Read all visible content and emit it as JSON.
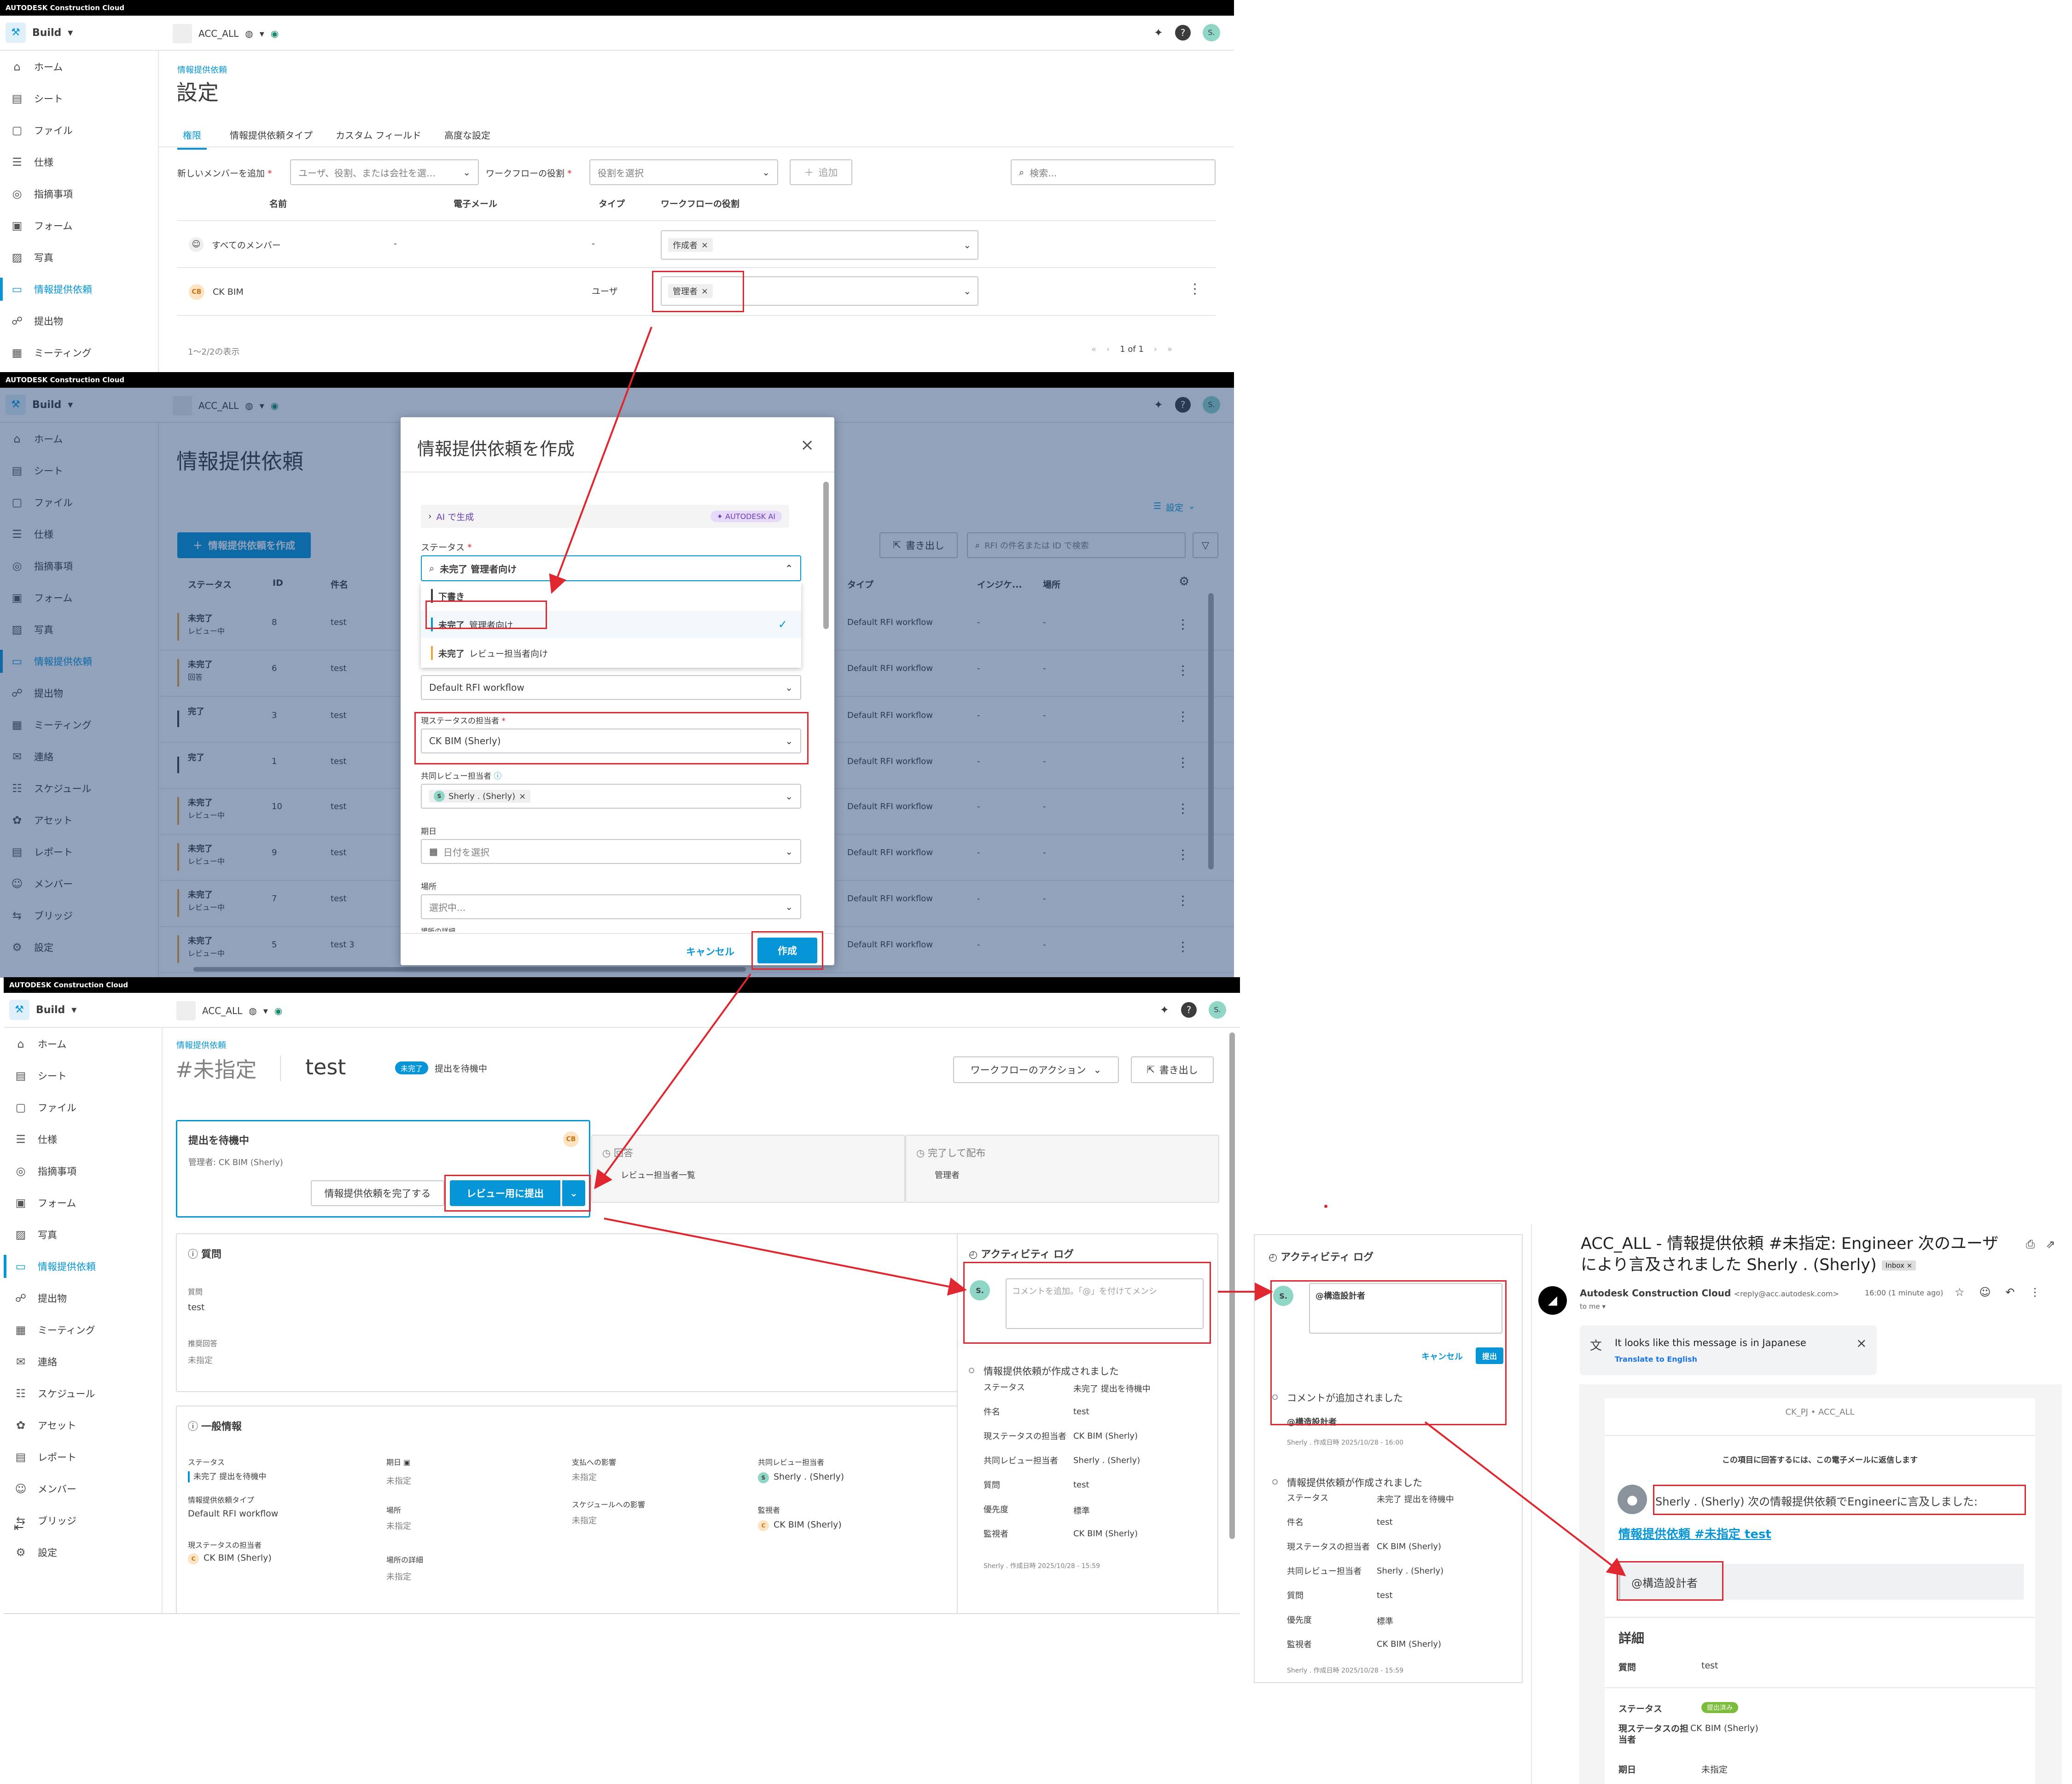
{
  "brand": "AUTODESK Construction Cloud",
  "header": {
    "app_menu": "Build",
    "project": "ACC_ALL",
    "user_initial": "S."
  },
  "sidebar": {
    "items": [
      "ホーム",
      "シート",
      "ファイル",
      "仕様",
      "指摘事項",
      "フォーム",
      "写真",
      "情報提供依頼",
      "提出物",
      "ミーティング",
      "連絡",
      "スケジュール",
      "アセット",
      "レポート",
      "メンバー",
      "ブリッジ",
      "設定"
    ],
    "icons": [
      "home-icon",
      "sheet-icon",
      "file-icon",
      "spec-icon",
      "issue-icon",
      "form-icon",
      "photo-icon",
      "rfi-icon",
      "submittal-icon",
      "meeting-icon",
      "mail-icon",
      "schedule-icon",
      "asset-icon",
      "report-icon",
      "members-icon",
      "bridge-icon",
      "gear-icon"
    ]
  },
  "settings": {
    "breadcrumb": "情報提供依頼",
    "title": "設定",
    "tabs": [
      "権限",
      "情報提供依頼タイプ",
      "カスタム フィールド",
      "高度な設定"
    ],
    "add_member_label": "新しいメンバーを追加",
    "add_member_placeholder": "ユーザ、役割、または会社を選…",
    "workflow_role_label": "ワークフローの役割",
    "role_placeholder": "役割を選択",
    "add_button": "追加",
    "search_placeholder": "検索...",
    "columns": [
      "名前",
      "電子メール",
      "タイプ",
      "ワークフローの役割"
    ],
    "rows": [
      {
        "name": "すべてのメンバー",
        "email": "-",
        "type": "-",
        "role": "作成者"
      },
      {
        "name": "CK BIM",
        "initials": "CB",
        "email": "",
        "type": "ユーザ",
        "role": "管理者"
      }
    ],
    "count_text": "1～2/2の表示",
    "pagination": "1 of 1"
  },
  "rfi_list": {
    "title": "情報提供依頼",
    "create_button": "情報提供依頼を作成",
    "settings_link": "設定",
    "export_button": "書き出し",
    "search_placeholder": "RFI の件名または ID で検索",
    "columns": [
      "ステータス",
      "ID",
      "件名",
      "タイプ",
      "インジケ...",
      "場所"
    ],
    "rows": [
      {
        "status": "未完了",
        "sub": "レビュー中",
        "id": "8",
        "subject": "test",
        "type": "Default RFI workflow",
        "ind": "-",
        "loc": "-",
        "color": "#f0a33c"
      },
      {
        "status": "未完了",
        "sub": "回答",
        "id": "6",
        "subject": "test",
        "type": "Default RFI workflow",
        "ind": "-",
        "loc": "-",
        "color": "#f0a33c"
      },
      {
        "status": "完了",
        "sub": "",
        "id": "3",
        "subject": "test",
        "type": "Default RFI workflow",
        "ind": "-",
        "loc": "-",
        "color": "#3c3c3c"
      },
      {
        "status": "完了",
        "sub": "",
        "id": "1",
        "subject": "test",
        "type": "Default RFI workflow",
        "ind": "-",
        "loc": "-",
        "color": "#3c3c3c"
      },
      {
        "status": "未完了",
        "sub": "レビュー中",
        "id": "10",
        "subject": "test",
        "type": "Default RFI workflow",
        "ind": "-",
        "loc": "-",
        "color": "#f0a33c"
      },
      {
        "status": "未完了",
        "sub": "レビュー中",
        "id": "9",
        "subject": "test",
        "type": "Default RFI workflow",
        "ind": "-",
        "loc": "-",
        "color": "#f0a33c"
      },
      {
        "status": "未完了",
        "sub": "レビュー中",
        "id": "7",
        "subject": "test",
        "type": "Default RFI workflow",
        "ind": "-",
        "loc": "-",
        "color": "#f0a33c"
      },
      {
        "status": "未完了",
        "sub": "レビュー中",
        "id": "5",
        "subject": "test 3",
        "type": "Default RFI workflow",
        "ind": "-",
        "loc": "-",
        "color": "#f0a33c"
      }
    ]
  },
  "modal": {
    "title": "情報提供依頼を作成",
    "ai_generate": "AI で生成",
    "ai_badge": "AUTODESK AI",
    "status_label": "ステータス",
    "status_value": "未完了 管理者向け",
    "options": [
      {
        "main": "下書き",
        "sub": "",
        "color": "#3c3c3c"
      },
      {
        "main": "未完了",
        "sub": "管理者向け",
        "color": "#0696d7"
      },
      {
        "main": "未完了",
        "sub": "レビュー担当者向け",
        "color": "#f0a33c"
      }
    ],
    "workflow_value": "Default RFI workflow",
    "assignee_label": "現ステータスの担当者",
    "assignee_value": "CK BIM (Sherly)",
    "coreviewer_label": "共同レビュー担当者",
    "coreviewer_value": "Sherly . (Sherly)",
    "due_label": "期日",
    "due_placeholder": "日付を選択",
    "location_label": "場所",
    "location_placeholder": "選択中...",
    "cut_label": "場所の詳細",
    "cancel": "キャンセル",
    "create": "作成"
  },
  "rfi_detail": {
    "breadcrumb": "情報提供依頼",
    "number": "#未指定",
    "subject": "test",
    "status_badge": "未完了",
    "status_text": "提出を待機中",
    "workflow_actions": "ワークフローのアクション",
    "export": "書き出し",
    "step1_title": "提出を待機中",
    "step1_manager": "管理者: CK BIM (Sherly)",
    "complete_button": "情報提供依頼を完了する",
    "submit_review": "レビュー用に提出",
    "step2_title": "回答",
    "step2_sub": "レビュー担当者一覧",
    "step3_title": "完了して配布",
    "step3_sub": "管理者",
    "question_title": "質問",
    "question_label": "質問",
    "question_value": "test",
    "answer_label": "推奨回答",
    "answer_value": "未指定",
    "general_title": "一般情報",
    "g_status_label": "ステータス",
    "g_status_value": "未完了 提出を待機中",
    "g_type_label": "情報提供依頼タイプ",
    "g_type_value": "Default RFI workflow",
    "g_assignee_label": "現ステータスの担当者",
    "g_assignee_value": "CK BIM (Sherly)",
    "g_due_label": "期日",
    "g_due_value": "未指定",
    "g_loc_label": "場所",
    "g_loc_value": "未指定",
    "g_locdetail_label": "場所の詳細",
    "g_locdetail_value": "未指定",
    "g_cost_label": "支払への影響",
    "g_cost_value": "未指定",
    "g_sched_label": "スケジュールへの影響",
    "g_sched_value": "未指定",
    "g_corev_label": "共同レビュー担当者",
    "g_corev_value": "Sherly . (Sherly)",
    "g_watch_label": "監視者",
    "g_watch_value": "CK BIM (Sherly)"
  },
  "activity": {
    "title": "アクティビティ ログ",
    "comment_placeholder": "コメントを追加。「@」を付けてメンシ",
    "created_event": "情報提供依頼が作成されました",
    "fields": [
      {
        "k": "ステータス",
        "v": "未完了 提出を待機中"
      },
      {
        "k": "件名",
        "v": "test"
      },
      {
        "k": "現ステータスの担当者",
        "v": "CK BIM (Sherly)"
      },
      {
        "k": "共同レビュー担当者",
        "v": "Sherly . (Sherly)"
      },
      {
        "k": "質問",
        "v": "test"
      },
      {
        "k": "優先度",
        "v": "標準"
      },
      {
        "k": "監視者",
        "v": "CK BIM (Sherly)"
      }
    ],
    "created_meta": "Sherly . 作成日時 2025/10/28 - 15:59"
  },
  "activity2": {
    "title": "アクティビティ ログ",
    "comment_text": "@構造設計者",
    "cancel": "キャンセル",
    "submit": "提出",
    "comment_added": "コメントが追加されました",
    "comment_body": "@構造設計者",
    "comment_meta": "Sherly . 作成日時 2025/10/28 - 16:00"
  },
  "email": {
    "subject": "ACC_ALL - 情報提供依頼 #未指定: Engineer 次のユーザにより言及されました Sherly . (Sherly)",
    "inbox_badge": "Inbox",
    "sender": "Autodesk Construction Cloud",
    "sender_addr": "<reply@acc.autodesk.com>",
    "time": "16:00 (1 minute ago)",
    "to": "to me",
    "translate_note": "It looks like this message is in Japanese",
    "translate_link": "Translate to English",
    "project": "CK_PJ • ACC_ALL",
    "reply_note": "この項目に回答するには、この電子メールに返信します",
    "mention_text": "Sherly . (Sherly) 次の情報提供依頼でEngineerに言及しました:",
    "link_text": "情報提供依頼 #未指定 test",
    "quote": "@構造設計者",
    "details_title": "詳細",
    "d_question_label": "質問",
    "d_question_value": "test",
    "d_status_label": "ステータス",
    "d_status_value": "提出済み",
    "d_assignee_label": "現ステータスの担当者",
    "d_assignee_value": "CK BIM (Sherly)",
    "d_due_label": "期日",
    "d_due_value": "未指定"
  },
  "colors": {
    "accent": "#0696d7",
    "warning": "#f0a33c",
    "highlight": "#e0262e",
    "overlay": "#173a6e"
  }
}
